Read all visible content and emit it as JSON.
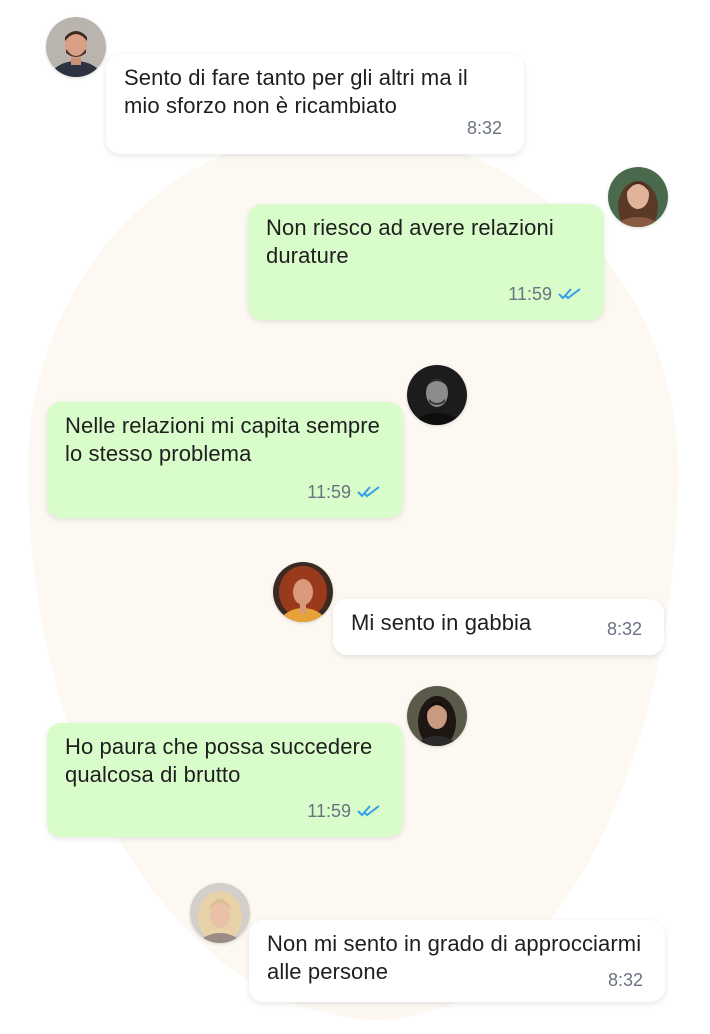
{
  "messages": [
    {
      "text": "Sento di fare tanto per gli altri ma il mio sforzo non è ricambiato",
      "time": "8:32",
      "style": "incoming",
      "read_ticks": false,
      "avatar": "avatar-man-beard"
    },
    {
      "text": "Non riesco ad avere relazioni durature",
      "time": "11:59",
      "style": "outgoing",
      "read_ticks": true,
      "avatar": "avatar-woman-brown-hair"
    },
    {
      "text": "Nelle relazioni mi capita sempre lo stesso problema",
      "time": "11:59",
      "style": "outgoing",
      "read_ticks": true,
      "avatar": "avatar-man-bw"
    },
    {
      "text": "Mi sento in gabbia",
      "time": "8:32",
      "style": "incoming",
      "read_ticks": false,
      "avatar": "avatar-woman-red-hair"
    },
    {
      "text": "Ho paura che possa succedere qualcosa di brutto",
      "time": "11:59",
      "style": "outgoing",
      "read_ticks": true,
      "avatar": "avatar-woman-dark-hair"
    },
    {
      "text": "Non mi sento in grado di approcciarmi alle persone",
      "time": "8:32",
      "style": "incoming",
      "read_ticks": false,
      "avatar": "avatar-woman-blonde"
    }
  ],
  "colors": {
    "incoming_bubble": "#ffffff",
    "outgoing_bubble": "#d9fccb",
    "read_ticks": "#34a0e8",
    "time_text": "#6b7280",
    "background_blob": "#fdf8f2"
  }
}
